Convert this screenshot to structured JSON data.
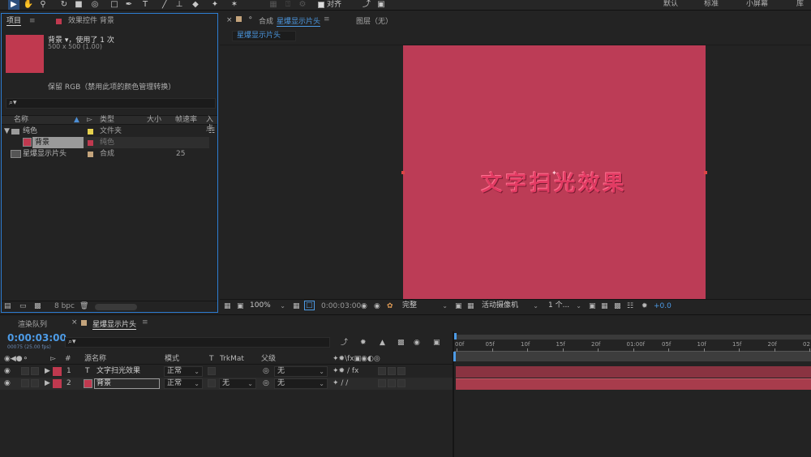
{
  "toolbar": {
    "tools": [
      "▶",
      "✋",
      "🔍",
      "↺",
      "■",
      "◌",
      "□",
      "✒",
      "T",
      "/",
      "⊥",
      "◆",
      "✦"
    ],
    "align_checkbox_label": "对齐",
    "workspaces": [
      "默认",
      "标准",
      "小屏幕",
      "库"
    ]
  },
  "project_panel": {
    "tab_label": "项目",
    "effects_tab_label": "效果控件 背景",
    "item_name": "背景 ▾，使用了 1 次",
    "item_info": "500 x 500 (1.00)",
    "color_note": "保留 RGB（禁用此项的颜色管理转换）",
    "search_icon": "⌕▾",
    "columns": [
      "名称",
      "类型",
      "大小",
      "帧速率",
      "入点"
    ],
    "rows": [
      {
        "name": "纯色",
        "type": "文件夹",
        "size": "",
        "fps": "",
        "folder": true,
        "swatch": "#e6d14e"
      },
      {
        "name": "背景",
        "type": "纯色",
        "size": "",
        "fps": "",
        "selected": true,
        "swatch": "#c0394f"
      },
      {
        "name": "星爆显示片头",
        "type": "合成",
        "size": "",
        "fps": "25",
        "swatch": "#c4a47c"
      }
    ],
    "bpc_label": "8 bpc"
  },
  "comp_panel": {
    "comp_tab_prefix": "合成",
    "comp_tab_name": "星爆显示片头",
    "layer_tab_label": "图层（无）",
    "breadcrumb": "星爆显示片头",
    "canvas_text": "文字扫光效果",
    "canvas_color": "#bc3c56",
    "zoom": "100%",
    "timecode": "0:00:03:00",
    "resolution": "完整",
    "camera": "活动摄像机",
    "views": "1 个...",
    "exposure": "+0.0"
  },
  "timeline": {
    "render_queue_tab": "渲染队列",
    "comp_tab": "星爆显示片头",
    "current_time": "0:00:03:00",
    "frame_info": "00075 (25.00 fps)",
    "search_icon": "⌕▾",
    "headers": {
      "num": "#",
      "source": "源名称",
      "mode": "模式",
      "t": "T",
      "trkmat": "TrkMat",
      "parent": "父级"
    },
    "layers": [
      {
        "index": "1",
        "type_icon": "T",
        "name": "文字扫光效果",
        "mode": "正常",
        "trkmat": "",
        "parent": "无",
        "color": "#c0394f"
      },
      {
        "index": "2",
        "type_icon": "■",
        "name": "背景",
        "mode": "正常",
        "trkmat": "无",
        "parent": "无",
        "color": "#c0394f"
      }
    ],
    "ruler_labels": [
      "00f",
      "05f",
      "10f",
      "15f",
      "20f",
      "01:00f",
      "05f",
      "10f",
      "15f",
      "20f",
      "02"
    ]
  }
}
